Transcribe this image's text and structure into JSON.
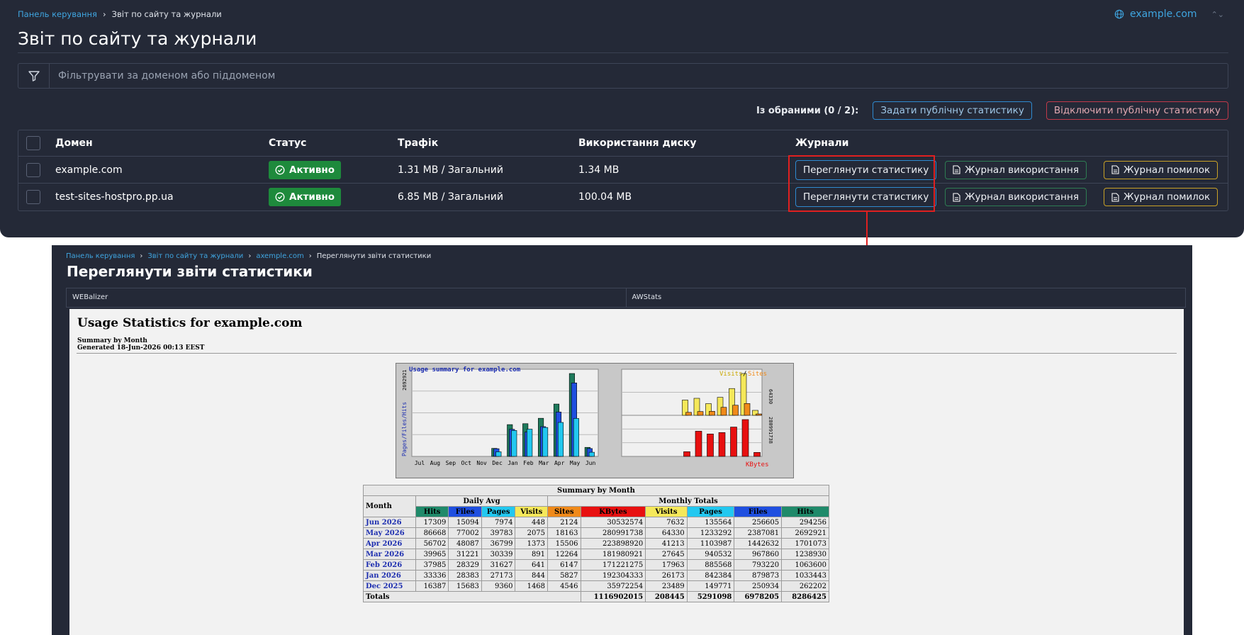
{
  "top": {
    "breadcrumb": {
      "home": "Панель керування",
      "current": "Звіт по сайту та журнали"
    },
    "domain_selector": "example.com",
    "title": "Звіт по сайту та журнали",
    "filter_placeholder": "Фільтрувати за доменом або піддоменом",
    "selection": {
      "label": "Із обраними (0 / 2):",
      "enable_btn": "Задати публічну статистику",
      "disable_btn": "Відключити публічну статистику"
    },
    "columns": {
      "domain": "Домен",
      "status": "Статус",
      "traffic": "Трафік",
      "disk": "Використання диску",
      "logs": "Журнали"
    },
    "rows": [
      {
        "domain": "example.com",
        "status": "Активно",
        "traffic": "1.31 MB / Загальний",
        "disk": "1.34 MB",
        "view_btn": "Переглянути статистику",
        "usage_btn": "Журнал використання",
        "error_btn": "Журнал помилок"
      },
      {
        "domain": "test-sites-hostpro.pp.ua",
        "status": "Активно",
        "traffic": "6.85 MB / Загальний",
        "disk": "100.04 MB",
        "view_btn": "Переглянути статистику",
        "usage_btn": "Журнал використання",
        "error_btn": "Журнал помилок"
      }
    ]
  },
  "bottom": {
    "breadcrumb": [
      "Панель керування",
      "Звіт по сайту та журнали",
      "axemple.com",
      "Переглянути звіти статистики"
    ],
    "title": "Переглянути звіти статистики",
    "tabs": [
      "WEBalizer",
      "AWStats"
    ],
    "report": {
      "title": "Usage Statistics for example.com",
      "sub1": "Summary by Month",
      "sub2": "Generated 18-Jun-2026 00:13 EEST"
    }
  },
  "chart_data": {
    "type": "bar",
    "title": "Usage summary for example.com",
    "categories": [
      "Jul",
      "Aug",
      "Sep",
      "Oct",
      "Nov",
      "Dec",
      "Jan",
      "Feb",
      "Mar",
      "Apr",
      "May",
      "Jun"
    ],
    "series": [
      {
        "name": "Hits",
        "values": [
          0,
          0,
          0,
          0,
          0,
          262202,
          1033443,
          1063600,
          1238930,
          1701073,
          2692921,
          294256
        ]
      },
      {
        "name": "Files",
        "values": [
          0,
          0,
          0,
          0,
          0,
          250934,
          879873,
          793220,
          967860,
          1442632,
          2387081,
          256605
        ]
      },
      {
        "name": "Pages",
        "values": [
          0,
          0,
          0,
          0,
          0,
          149771,
          842384,
          885568,
          940532,
          1103987,
          1233292,
          135564
        ]
      },
      {
        "name": "Visits",
        "values": [
          0,
          0,
          0,
          0,
          0,
          23489,
          26173,
          17963,
          27645,
          41213,
          64330,
          7632
        ]
      },
      {
        "name": "Sites",
        "values": [
          0,
          0,
          0,
          0,
          0,
          4546,
          5827,
          6147,
          12264,
          15506,
          18163,
          2124
        ]
      },
      {
        "name": "KBytes",
        "values": [
          0,
          0,
          0,
          0,
          0,
          35972254,
          192304333,
          171221275,
          181980921,
          223898920,
          280991738,
          30532574
        ]
      }
    ],
    "left_axis_max_label": "2692921",
    "visits_axis_max_label": "64330",
    "kbytes_axis_max_label": "280991738",
    "legend_left": "Pages/Files/Hits",
    "legend_visits": "Visits",
    "legend_sites": "Sites",
    "legend_kbytes": "KBytes",
    "colors": {
      "hits": "#1f7a5c",
      "files": "#1f4fe0",
      "pages": "#22c8f0",
      "visits": "#f5e85a",
      "sites": "#f08a1a",
      "kbytes": "#e81010"
    }
  },
  "summary_table": {
    "caption": "Summary by Month",
    "month_header": "Month",
    "daily_avg": "Daily Avg",
    "monthly_totals": "Monthly Totals",
    "cols": [
      "Hits",
      "Files",
      "Pages",
      "Visits",
      "Sites",
      "KBytes",
      "Visits",
      "Pages",
      "Files",
      "Hits"
    ],
    "col_colors": [
      "#1f8a6a",
      "#1f4fe0",
      "#22c8f0",
      "#f5e85a",
      "#f08a1a",
      "#e81010",
      "#f5e85a",
      "#22c8f0",
      "#1f4fe0",
      "#1f8a6a"
    ],
    "rows": [
      [
        "Jun 2026",
        "17309",
        "15094",
        "7974",
        "448",
        "2124",
        "30532574",
        "7632",
        "135564",
        "256605",
        "294256"
      ],
      [
        "May 2026",
        "86668",
        "77002",
        "39783",
        "2075",
        "18163",
        "280991738",
        "64330",
        "1233292",
        "2387081",
        "2692921"
      ],
      [
        "Apr 2026",
        "56702",
        "48087",
        "36799",
        "1373",
        "15506",
        "223898920",
        "41213",
        "1103987",
        "1442632",
        "1701073"
      ],
      [
        "Mar 2026",
        "39965",
        "31221",
        "30339",
        "891",
        "12264",
        "181980921",
        "27645",
        "940532",
        "967860",
        "1238930"
      ],
      [
        "Feb 2026",
        "37985",
        "28329",
        "31627",
        "641",
        "6147",
        "171221275",
        "17963",
        "885568",
        "793220",
        "1063600"
      ],
      [
        "Jan 2026",
        "33336",
        "28383",
        "27173",
        "844",
        "5827",
        "192304333",
        "26173",
        "842384",
        "879873",
        "1033443"
      ],
      [
        "Dec 2025",
        "16387",
        "15683",
        "9360",
        "1468",
        "4546",
        "35972254",
        "23489",
        "149771",
        "250934",
        "262202"
      ]
    ],
    "totals": {
      "label": "Totals",
      "values": [
        "1116902015",
        "208445",
        "5291098",
        "6978205",
        "8286425"
      ]
    }
  }
}
